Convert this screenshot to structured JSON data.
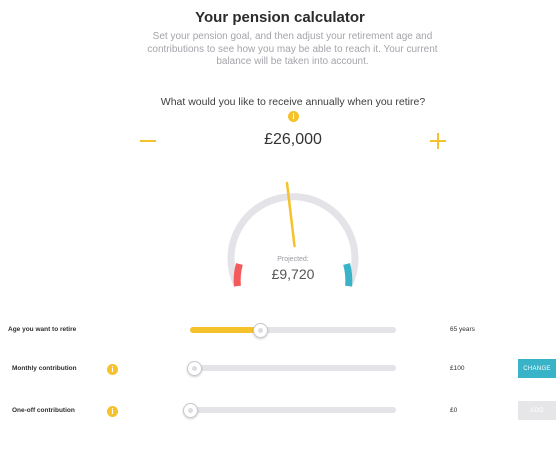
{
  "header": {
    "title": "Your pension calculator",
    "subtitle": "Set your pension goal, and then adjust your retirement age and contributions to see how you may be able to reach it. Your current balance will be taken into account."
  },
  "goal": {
    "question": "What would you like to receive annually when you retire?",
    "value": "£26,000",
    "decrease_icon": "minus-icon",
    "increase_icon": "plus-icon"
  },
  "gauge": {
    "projected_label": "Projected:",
    "projected_value": "£9,720",
    "pointer_fraction": 0.46,
    "colors": {
      "track": "#e3e3e8",
      "low": "#f4595c",
      "high": "#38b3c7",
      "pointer": "#f5c22b"
    }
  },
  "controls": {
    "retirement_age": {
      "label": "Age you want to retire",
      "value": "65 years",
      "level": 0.34
    },
    "monthly_contribution": {
      "label": "Monthly contribution",
      "value": "£100",
      "level": 0.02,
      "button": "CHANGE",
      "info_icon": "info-icon"
    },
    "one_off_contribution": {
      "label": "One-off contribution",
      "value": "£0",
      "level": 0.0,
      "button": "ADD",
      "info_icon": "info-icon"
    }
  },
  "colors": {
    "accent": "#f5c22b",
    "teal": "#38b3c7",
    "coral": "#f4595c"
  }
}
